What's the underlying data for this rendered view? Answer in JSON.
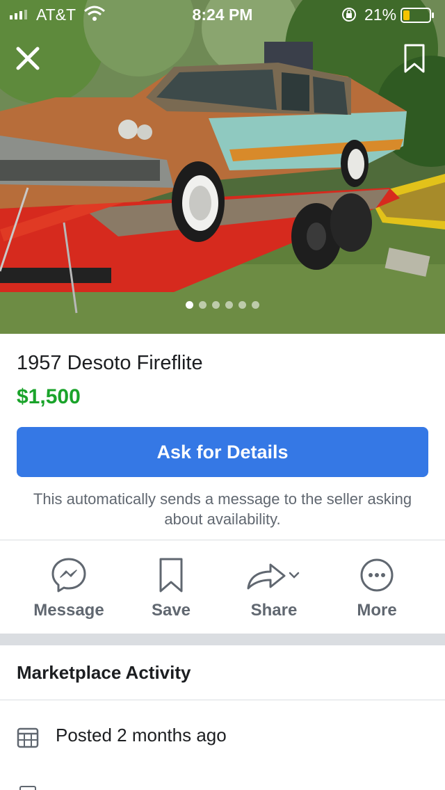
{
  "status_bar": {
    "carrier": "AT&T",
    "time": "8:24 PM",
    "battery": "21%"
  },
  "photo": {
    "subject": "rusty 1957 car on red trailer",
    "total_photos": 6,
    "active_photo": 1
  },
  "listing": {
    "title": "1957 Desoto Fireflite",
    "price": "$1,500",
    "ask_button_label": "Ask for Details",
    "ask_note": "This automatically sends a message to the seller asking about availability."
  },
  "actions": [
    {
      "label": "Message",
      "icon": "messenger-icon"
    },
    {
      "label": "Save",
      "icon": "bookmark-icon"
    },
    {
      "label": "Share",
      "icon": "share-icon"
    },
    {
      "label": "More",
      "icon": "more-icon"
    }
  ],
  "activity": {
    "title": "Marketplace Activity",
    "posted": "Posted 2 months ago"
  },
  "colors": {
    "accent": "#3578e5",
    "price": "#1aa32a",
    "secondary_text": "#606770"
  }
}
